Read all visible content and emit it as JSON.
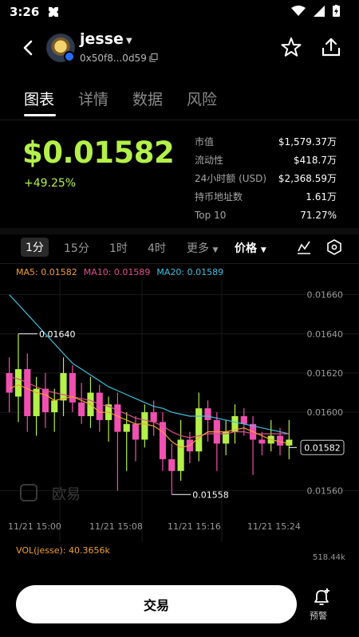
{
  "status": {
    "time": "3:26"
  },
  "header": {
    "token_name": "jesse",
    "address": "0x50f8...0d59"
  },
  "tabs": [
    {
      "label": "图表"
    },
    {
      "label": "详情"
    },
    {
      "label": "数据"
    },
    {
      "label": "风险"
    }
  ],
  "price": {
    "value": "$0.01582",
    "change": "+49.25%"
  },
  "stats": [
    {
      "label": "市值",
      "value": "$1,579.37万"
    },
    {
      "label": "流动性",
      "value": "$418.7万"
    },
    {
      "label": "24小时额 (USD)",
      "value": "$2,368.59万"
    },
    {
      "label": "持币地址数",
      "value": "1.61万"
    },
    {
      "label": "Top 10",
      "value": "71.27%"
    }
  ],
  "timeframes": {
    "t1": "1分",
    "t15": "15分",
    "h1": "1时",
    "h4": "4时",
    "more": "更多",
    "price": "价格"
  },
  "ma_legend": {
    "ma5": "MA5: 0.01582",
    "ma10": "MA10: 0.01589",
    "ma20": "MA20: 0.01589"
  },
  "colors": {
    "up": "#b4f04a",
    "down": "#f050b0",
    "ma5": "#f0a030",
    "ma10": "#e0508a",
    "ma20": "#40c0e0"
  },
  "chart_data": {
    "type": "candlestick",
    "y_ticks": [
      "0.01660",
      "0.01640",
      "0.01620",
      "0.01600",
      "0.01560"
    ],
    "x_ticks": [
      "11/21 15:00",
      "11/21 15:08",
      "11/21 15:16",
      "11/21 15:24"
    ],
    "annotations": {
      "high": "0.01640",
      "low": "0.01558",
      "last": "0.01582"
    },
    "ylim": [
      0.01552,
      0.01668
    ],
    "candles": [
      [
        0.0162,
        0.0161,
        0.01628,
        0.016
      ],
      [
        0.01608,
        0.01622,
        0.0164,
        0.01595
      ],
      [
        0.01622,
        0.01598,
        0.0163,
        0.0159
      ],
      [
        0.01598,
        0.01612,
        0.01618,
        0.01588
      ],
      [
        0.01612,
        0.016,
        0.0162,
        0.01592
      ],
      [
        0.016,
        0.01606,
        0.01612,
        0.0159
      ],
      [
        0.01606,
        0.0162,
        0.01628,
        0.01598
      ],
      [
        0.0162,
        0.01605,
        0.01624,
        0.016
      ],
      [
        0.01605,
        0.01598,
        0.01615,
        0.01594
      ],
      [
        0.01598,
        0.0161,
        0.01618,
        0.01592
      ],
      [
        0.0161,
        0.01596,
        0.01614,
        0.0159
      ],
      [
        0.01596,
        0.01604,
        0.01608,
        0.01585
      ],
      [
        0.01604,
        0.0159,
        0.0161,
        0.0156
      ],
      [
        0.0159,
        0.01594,
        0.016,
        0.0157
      ],
      [
        0.01594,
        0.01586,
        0.01598,
        0.01575
      ],
      [
        0.01586,
        0.016,
        0.01604,
        0.01582
      ],
      [
        0.016,
        0.01595,
        0.01606,
        0.01588
      ],
      [
        0.01595,
        0.01576,
        0.016,
        0.0157
      ],
      [
        0.01576,
        0.0157,
        0.01584,
        0.01558
      ],
      [
        0.0157,
        0.01586,
        0.01596,
        0.01565
      ],
      [
        0.01586,
        0.0158,
        0.0159,
        0.01574
      ],
      [
        0.0158,
        0.01602,
        0.0161,
        0.01575
      ],
      [
        0.01602,
        0.01596,
        0.01606,
        0.01585
      ],
      [
        0.01596,
        0.01584,
        0.016,
        0.0157
      ],
      [
        0.01584,
        0.0159,
        0.01596,
        0.01578
      ],
      [
        0.0159,
        0.01598,
        0.01604,
        0.01584
      ],
      [
        0.01598,
        0.01594,
        0.01602,
        0.01588
      ],
      [
        0.01594,
        0.01586,
        0.01598,
        0.01568
      ],
      [
        0.01586,
        0.01584,
        0.0159,
        0.01578
      ],
      [
        0.01584,
        0.01588,
        0.01596,
        0.0158
      ],
      [
        0.01588,
        0.01583,
        0.01592,
        0.01578
      ],
      [
        0.01583,
        0.01586,
        0.01596,
        0.01576
      ]
    ],
    "ma5": [
      0.01612,
      0.01614,
      0.01612,
      0.0161,
      0.01609,
      0.01606,
      0.01607,
      0.01608,
      0.01606,
      0.01604,
      0.016,
      0.016,
      0.01598,
      0.01596,
      0.01594,
      0.01594,
      0.01593,
      0.0159,
      0.01585,
      0.01582,
      0.01583,
      0.01587,
      0.0159,
      0.0159,
      0.0159,
      0.01591,
      0.01592,
      0.0159,
      0.01588,
      0.01586,
      0.01585,
      0.01584
    ],
    "ma10": [
      0.01618,
      0.01617,
      0.01615,
      0.01613,
      0.01611,
      0.0161,
      0.01609,
      0.01608,
      0.01607,
      0.01606,
      0.01604,
      0.01603,
      0.01601,
      0.01599,
      0.01597,
      0.01596,
      0.01595,
      0.01593,
      0.0159,
      0.01588,
      0.01587,
      0.01588,
      0.01589,
      0.01589,
      0.01589,
      0.0159,
      0.0159,
      0.01589,
      0.01589,
      0.01589,
      0.01589,
      0.01589
    ],
    "ma20": [
      0.0166,
      0.01655,
      0.0165,
      0.01645,
      0.0164,
      0.01635,
      0.0163,
      0.01625,
      0.01622,
      0.01619,
      0.01616,
      0.01613,
      0.01611,
      0.01609,
      0.01607,
      0.01605,
      0.01603,
      0.01602,
      0.016,
      0.01599,
      0.01598,
      0.01598,
      0.01598,
      0.01597,
      0.01596,
      0.01595,
      0.01594,
      0.01593,
      0.01592,
      0.01591,
      0.0159,
      0.01589
    ]
  },
  "volume": {
    "label": "VOL(jesse): 40.3656k",
    "max": "518.44k"
  },
  "footer": {
    "trade_label": "交易",
    "alert_label": "预警"
  }
}
